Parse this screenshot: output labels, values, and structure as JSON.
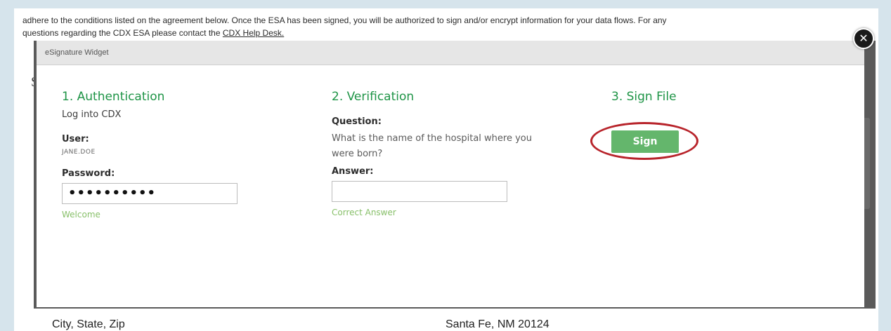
{
  "background_page": {
    "intro_line_1": "adhere to the conditions listed on the agreement below. Once the ESA has been signed, you will be authorized to sign and/or encrypt information for your data flows. For any",
    "intro_line_2_prefix": "questions regarding the CDX ESA please contact the",
    "help_desk_link": "CDX Help Desk.",
    "side_letter": "Si",
    "bottom_label": "City, State, Zip",
    "bottom_value": "Santa Fe, NM 20124"
  },
  "modal": {
    "header_title": "eSignature Widget",
    "close_glyph": "✕",
    "authentication": {
      "title": "1. Authentication",
      "subtitle": "Log into CDX",
      "user_label": "User:",
      "user_value": "JANE.DOE",
      "password_label": "Password:",
      "password_value": "••••••••••",
      "status": "Welcome"
    },
    "verification": {
      "title": "2. Verification",
      "question_label": "Question:",
      "question_text": "What is the name of the hospital where you were born?",
      "answer_label": "Answer:",
      "answer_value": "",
      "status": "Correct Answer"
    },
    "sign": {
      "title": "3. Sign File",
      "button_label": "Sign"
    }
  },
  "colors": {
    "step_title": "#1e9446",
    "status_green": "#88c06a",
    "sign_button": "#64b66c",
    "highlight_ellipse": "#b8242b",
    "overlay": "#5a5a5a",
    "outer_background": "#d6e4ec"
  }
}
